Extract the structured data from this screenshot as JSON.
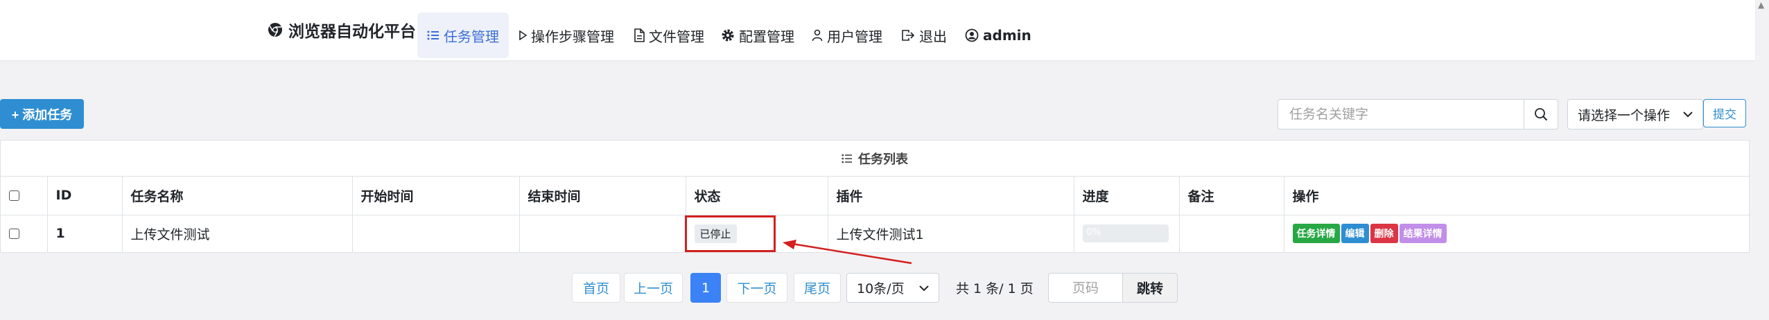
{
  "brand": {
    "title": "浏览器自动化平台",
    "icon": "chrome-icon"
  },
  "nav": {
    "items": [
      {
        "label": "任务管理",
        "icon": "list-icon",
        "active": true
      },
      {
        "label": "操作步骤管理",
        "icon": "play-icon"
      },
      {
        "label": "文件管理",
        "icon": "file-icon"
      },
      {
        "label": "配置管理",
        "icon": "gear-icon"
      },
      {
        "label": "用户管理",
        "icon": "user-icon"
      },
      {
        "label": "退出",
        "icon": "logout-icon"
      }
    ],
    "user": "admin"
  },
  "toolbar": {
    "add_label": "+ 添加任务",
    "search_placeholder": "任务名关键字",
    "operation_select": "请选择一个操作",
    "submit_label": "提交"
  },
  "table": {
    "caption": "任务列表",
    "headers": [
      "ID",
      "任务名称",
      "开始时间",
      "结束时间",
      "状态",
      "插件",
      "进度",
      "备注",
      "操作"
    ],
    "rows": [
      {
        "id": "1",
        "name": "上传文件测试",
        "start": "",
        "end": "",
        "status": "已停止",
        "plugin": "上传文件测试1",
        "progress_text": "0%",
        "progress": 0,
        "note": "",
        "actions": [
          "任务详情",
          "编辑",
          "删除",
          "结果详情"
        ]
      }
    ]
  },
  "pagination": {
    "first": "首页",
    "prev": "上一页",
    "current": "1",
    "next": "下一页",
    "last": "尾页",
    "page_size": "10条/页",
    "summary": "共 1 条/ 1 页",
    "page_input_placeholder": "页码",
    "jump": "跳转"
  },
  "colors": {
    "primary": "#2f8ed1",
    "active_page": "#3b82f6",
    "annotation": "#d41f1f",
    "success": "#28a745",
    "danger": "#dc3545",
    "result": "#c18ee8"
  }
}
